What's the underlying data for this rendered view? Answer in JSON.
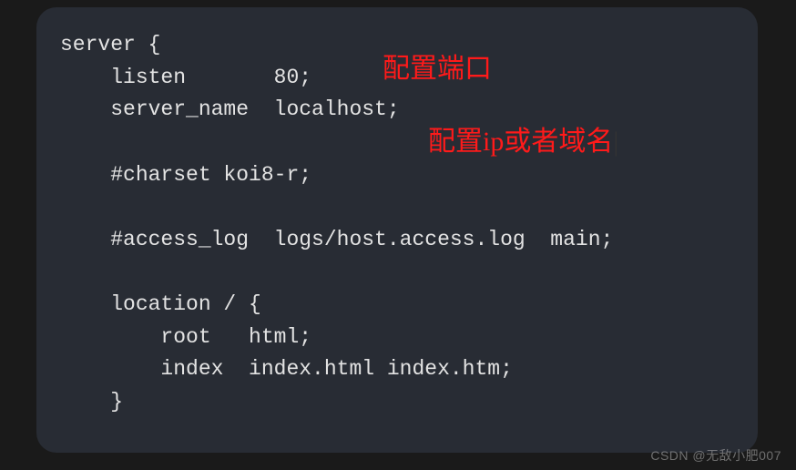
{
  "code": {
    "line1": "server {",
    "line2": "    listen       80;",
    "line3": "    server_name  localhost;",
    "line4": "    #charset koi8-r;",
    "line5": "    #access_log  logs/host.access.log  main;",
    "line6": "    location / {",
    "line7": "        root   html;",
    "line8": "        index  index.html index.htm;",
    "line9": "    }"
  },
  "annotations": {
    "port": "配置端口",
    "domain": "配置ip或者域名"
  },
  "watermark": "CSDN @无敌小肥007"
}
